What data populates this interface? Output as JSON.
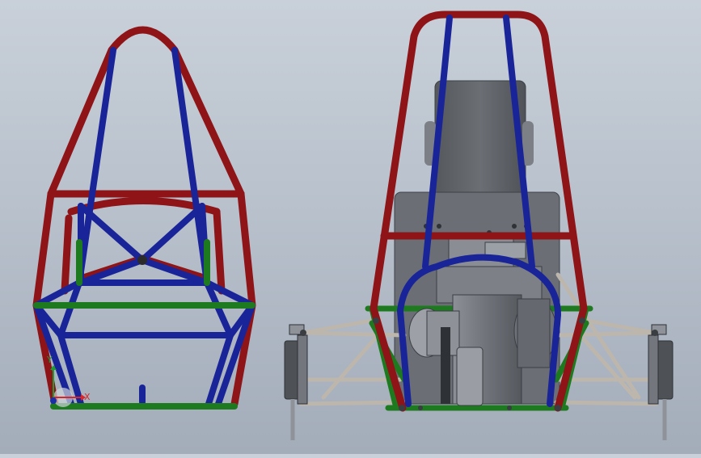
{
  "viewport": {
    "background_top": "#c9d0d9",
    "background_bottom": "#a3acb9"
  },
  "colors": {
    "main_hoop": "#8e1418",
    "bracing": "#1a2499",
    "lower_members": "#1e7a1e",
    "suspension_arms": "#bdb6ad",
    "engine_body": "#74787e",
    "seat_panel": "#5d6166",
    "firewall": "#6b6f75",
    "wheel_hub": "#4e5257"
  },
  "triad": {
    "x_label": "X",
    "y_label": "Y",
    "x_color": "#d8262b",
    "y_color": "#1f9a34",
    "z_color": "#1a2ea8"
  },
  "views": [
    {
      "name": "side-view",
      "description_icon": "frame-side-icon"
    },
    {
      "name": "rear-view",
      "description_icon": "frame-rear-icon"
    }
  ]
}
